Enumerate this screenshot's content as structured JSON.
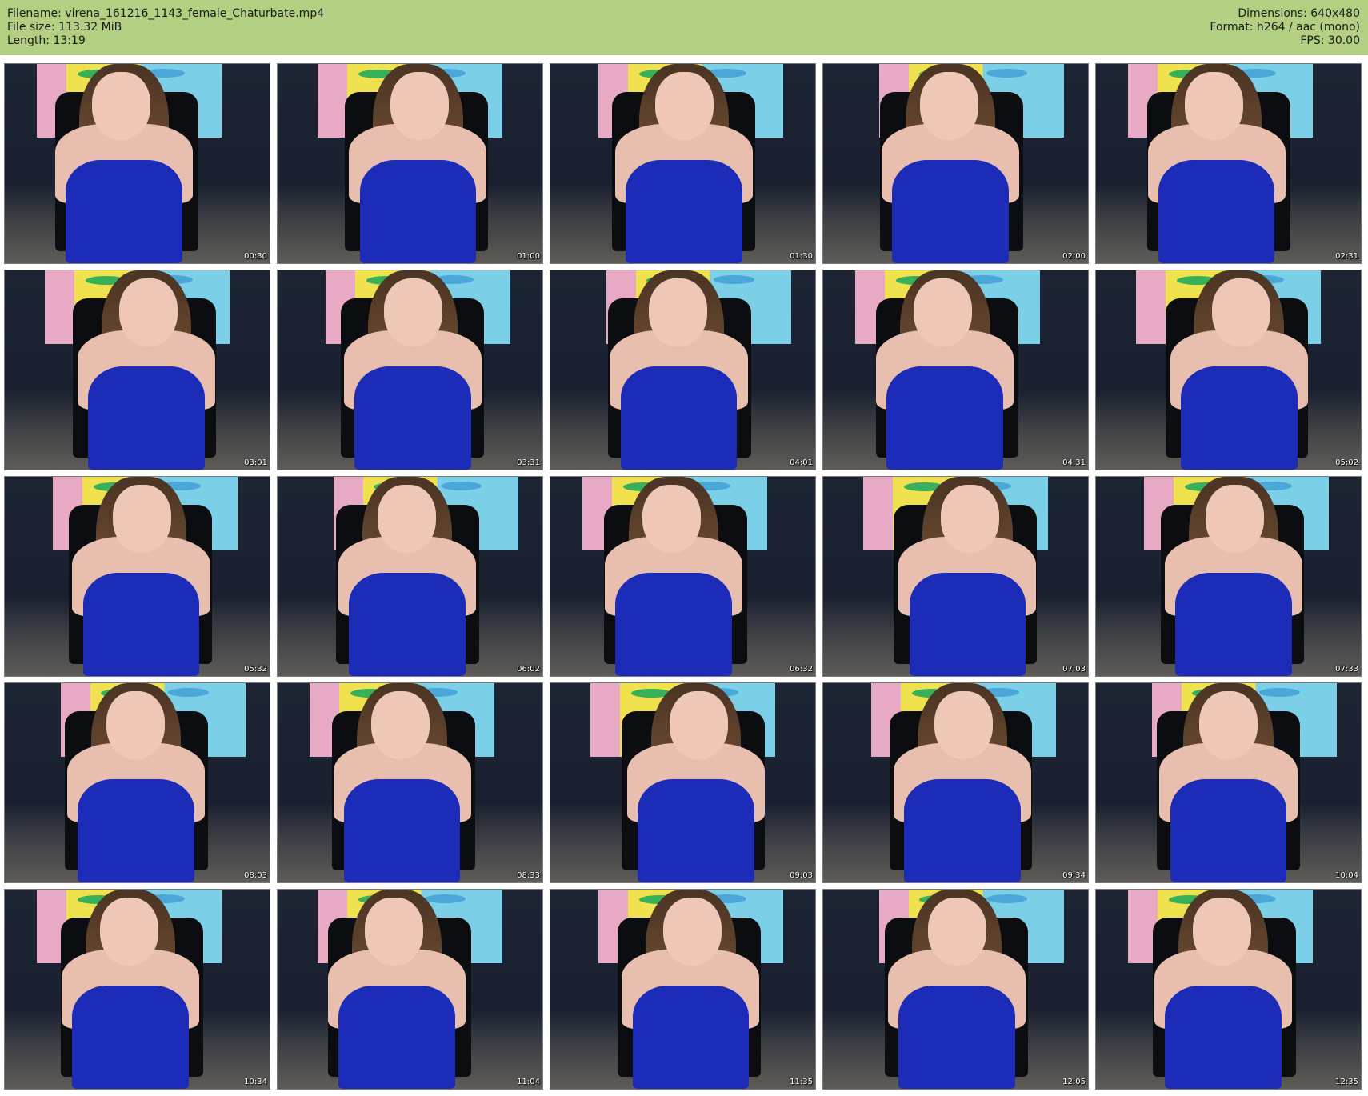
{
  "header": {
    "filename": "Filename: virena_161216_1143_female_Chaturbate.mp4",
    "file_size": "File size: 113.32 MiB",
    "length": "Length: 13:19",
    "dimensions": "Dimensions: 640x480",
    "format": "Format: h264 / aac (mono)",
    "fps": "FPS: 30.00"
  },
  "colors": {
    "header_bg": "#b3cf82",
    "dress": "#1c2bb8"
  },
  "thumbnails": [
    {
      "timestamp": "00:30"
    },
    {
      "timestamp": "01:00"
    },
    {
      "timestamp": "01:30"
    },
    {
      "timestamp": "02:00"
    },
    {
      "timestamp": "02:31"
    },
    {
      "timestamp": "03:01"
    },
    {
      "timestamp": "03:31"
    },
    {
      "timestamp": "04:01"
    },
    {
      "timestamp": "04:31"
    },
    {
      "timestamp": "05:02"
    },
    {
      "timestamp": "05:32"
    },
    {
      "timestamp": "06:02"
    },
    {
      "timestamp": "06:32"
    },
    {
      "timestamp": "07:03"
    },
    {
      "timestamp": "07:33"
    },
    {
      "timestamp": "08:03"
    },
    {
      "timestamp": "08:33"
    },
    {
      "timestamp": "09:03"
    },
    {
      "timestamp": "09:34"
    },
    {
      "timestamp": "10:04"
    },
    {
      "timestamp": "10:34"
    },
    {
      "timestamp": "11:04"
    },
    {
      "timestamp": "11:35"
    },
    {
      "timestamp": "12:05"
    },
    {
      "timestamp": "12:35"
    }
  ]
}
